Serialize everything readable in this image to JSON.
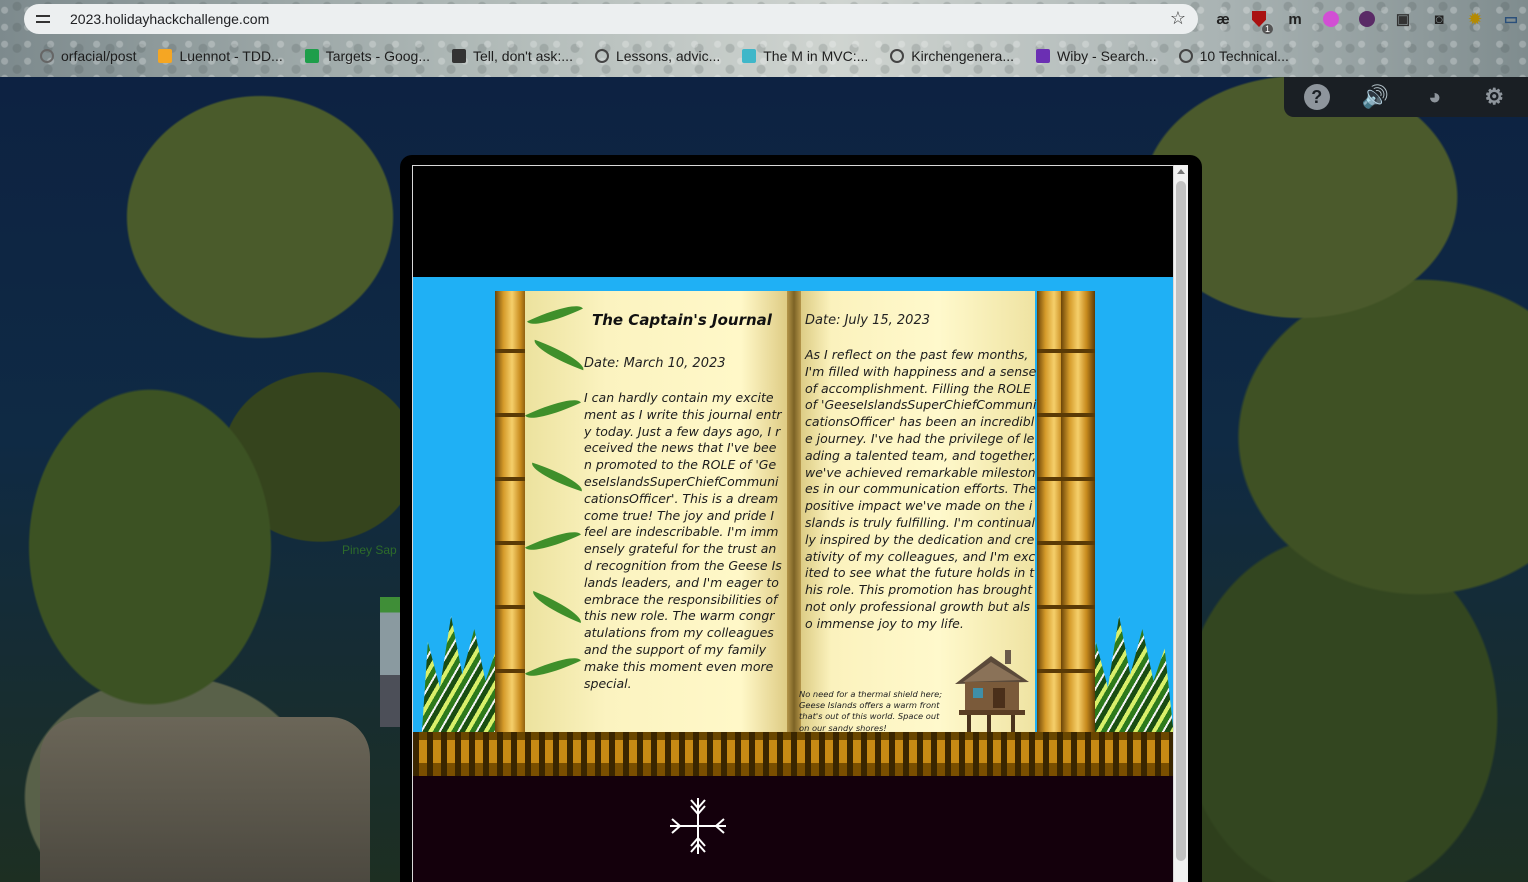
{
  "browser": {
    "url": "2023.holidayhackchallenge.com",
    "extensions": [
      {
        "icon": "ae-ligature-icon",
        "glyph": "æ",
        "color": "#222"
      },
      {
        "icon": "shield-badge-icon",
        "glyph": "",
        "color": "#a11"
      },
      {
        "icon": "m-letter-icon",
        "glyph": "m",
        "color": "#222"
      },
      {
        "icon": "pink-circle-icon",
        "glyph": "",
        "color": "#d24fd4"
      },
      {
        "icon": "purple-circle-icon",
        "glyph": "",
        "color": "#5a2a66"
      },
      {
        "icon": "screenshot-icon",
        "glyph": "▣",
        "color": "#333"
      },
      {
        "icon": "mask-icon",
        "glyph": "◙",
        "color": "#222"
      },
      {
        "icon": "sparkle-icon",
        "glyph": "✹",
        "color": "#b58a00"
      },
      {
        "icon": "monitor-icon",
        "glyph": "▭",
        "color": "#2a4f7a"
      }
    ],
    "shield_badge_count": "1",
    "bookmarks": [
      {
        "label": "orfacial/post",
        "icon": "circle-icon",
        "color": "#666"
      },
      {
        "label": "Luennot - TDD...",
        "icon": "square-icon",
        "color": "#f5a623"
      },
      {
        "label": "Targets - Goog...",
        "icon": "sheets-icon",
        "color": "#1e9e4a"
      },
      {
        "label": "Tell, don't ask:...",
        "icon": "book-icon",
        "color": "#333"
      },
      {
        "label": "Lessons, advic...",
        "icon": "globe-icon",
        "color": "#444"
      },
      {
        "label": "The M in MVC:...",
        "icon": "heart-icon",
        "color": "#3fb7c9"
      },
      {
        "label": "Kirchengenera...",
        "icon": "globe-icon",
        "color": "#444"
      },
      {
        "label": "Wiby - Search...",
        "icon": "w-icon",
        "color": "#6b2fb3"
      },
      {
        "label": "10 Technical...",
        "icon": "globe-icon",
        "color": "#444"
      }
    ]
  },
  "game": {
    "location_label": "Piney Sap",
    "controls": [
      {
        "name": "help-icon",
        "glyph": "?"
      },
      {
        "name": "volume-icon",
        "glyph": "🔊"
      },
      {
        "name": "discord-icon",
        "glyph": "◕"
      },
      {
        "name": "settings-gear-icon",
        "glyph": "⚙"
      }
    ]
  },
  "journal": {
    "title": "The Captain's Journal",
    "left_date": "Date: March 10, 2023",
    "left_body": "I can hardly contain my excitement as I write this journal entry today. Just a few days ago, I received the news that I've been promoted to the ROLE of 'GeeseIslandsSuperChiefCommunicationsOfficer'. This is a dream come true! The joy and pride I feel are indescribable. I'm immensely grateful for the trust and recognition from the Geese Islands leaders, and I'm eager to embrace the responsibilities of this new role. The warm congratulations from my colleagues and the support of my family make this moment even more special.",
    "right_date": "Date: July 15, 2023",
    "right_body": "As I reflect on the past few months, I'm filled with happiness and a sense of accomplishment. Filling the ROLE of 'GeeseIslandsSuperChiefCommunicationsOfficer' has been an incredible journey. I've had the privilege of leading a talented team, and together, we've achieved remarkable milestones in our communication efforts. The positive impact we've made on the islands is truly fulfilling. I'm continually inspired by the dedication and creativity of my colleagues, and I'm excited to see what the future holds in this role. This promotion has brought not only professional growth but also immense joy to my life.",
    "footnote": "No need for a thermal shield here; Geese Islands offers a warm front that's out of this world. Space out on our sandy shores!"
  }
}
